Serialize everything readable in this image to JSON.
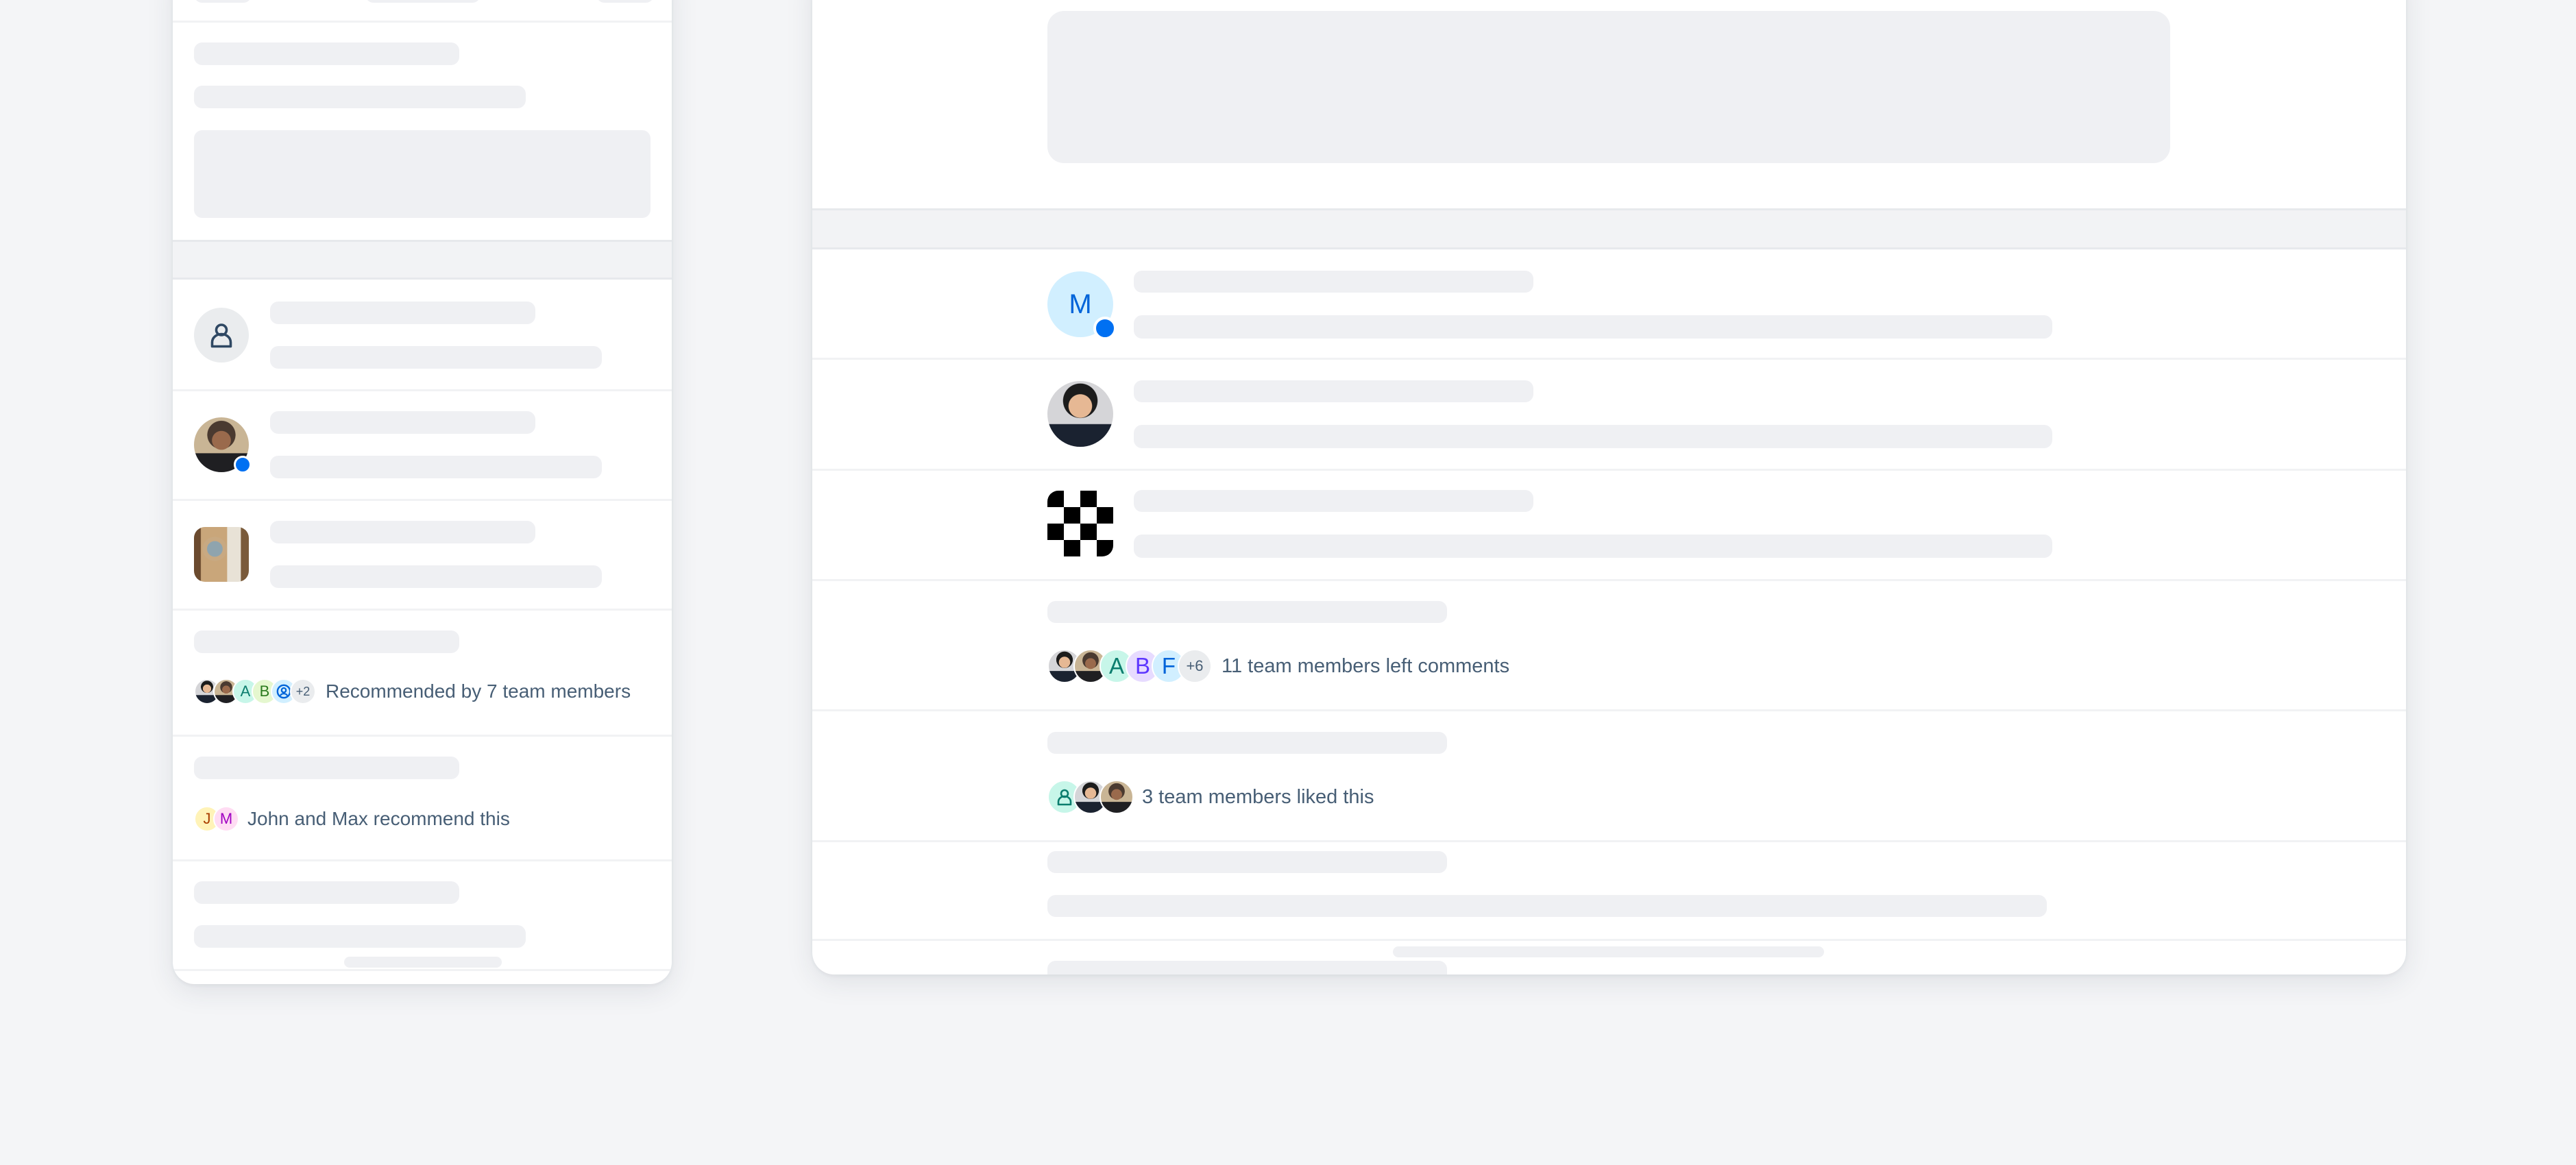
{
  "colors": {
    "page_bg": "#f4f5f7",
    "panel_bg": "#ffffff",
    "skeleton": "#eff0f3",
    "online_dot": "#0070f2",
    "text": "#475e75"
  },
  "left_panel": {
    "list": [
      {
        "avatar": "person-placeholder-icon",
        "online": false
      },
      {
        "avatar": "photo-woman",
        "online": true
      },
      {
        "avatar": "photo-machine",
        "online": false
      }
    ],
    "recommended": {
      "avatars": [
        {
          "type": "photo",
          "name": "photo-man"
        },
        {
          "type": "photo",
          "name": "photo-woman"
        },
        {
          "type": "initial",
          "label": "A",
          "bg": "#c7f6e9",
          "fg": "#0b7d6e"
        },
        {
          "type": "initial",
          "label": "B",
          "bg": "#e5f7cf",
          "fg": "#2b7a1e"
        },
        {
          "type": "icon",
          "label": "@",
          "bg": "#d1efff",
          "fg": "#0064d9"
        },
        {
          "type": "overflow",
          "label": "+2",
          "bg": "#eaecee",
          "fg": "#475e75"
        }
      ],
      "text": "Recommended by 7 team members"
    },
    "john_max": {
      "avatars": [
        {
          "type": "initial",
          "label": "J",
          "bg": "#fff3b8",
          "fg": "#a93e00"
        },
        {
          "type": "initial",
          "label": "M",
          "bg": "#ffdcf3",
          "fg": "#a100c2"
        }
      ],
      "text": "John and Max recommend this"
    }
  },
  "right_panel": {
    "list": [
      {
        "avatar": "initial",
        "label": "M",
        "bg": "#d1efff",
        "fg": "#0064d9",
        "online": true
      },
      {
        "avatar": "photo-man",
        "online": false
      },
      {
        "avatar": "checkerboard-logo",
        "online": false
      }
    ],
    "comments": {
      "avatars": [
        {
          "type": "photo",
          "name": "photo-man"
        },
        {
          "type": "photo",
          "name": "photo-woman"
        },
        {
          "type": "initial",
          "label": "A",
          "bg": "#c7f6e9",
          "fg": "#0b7d6e"
        },
        {
          "type": "initial",
          "label": "B",
          "bg": "#e7dbff",
          "fg": "#5d36ff"
        },
        {
          "type": "initial",
          "label": "F",
          "bg": "#d1efff",
          "fg": "#0064d9"
        },
        {
          "type": "overflow",
          "label": "+6",
          "bg": "#eaecee",
          "fg": "#475e75"
        }
      ],
      "text": "11 team members left comments"
    },
    "liked": {
      "avatars": [
        {
          "type": "icon",
          "name": "person-icon",
          "bg": "#c7f6e9",
          "fg": "#0b7d6e"
        },
        {
          "type": "photo",
          "name": "photo-man"
        },
        {
          "type": "photo",
          "name": "photo-woman"
        }
      ],
      "text": "3 team members liked this"
    }
  }
}
